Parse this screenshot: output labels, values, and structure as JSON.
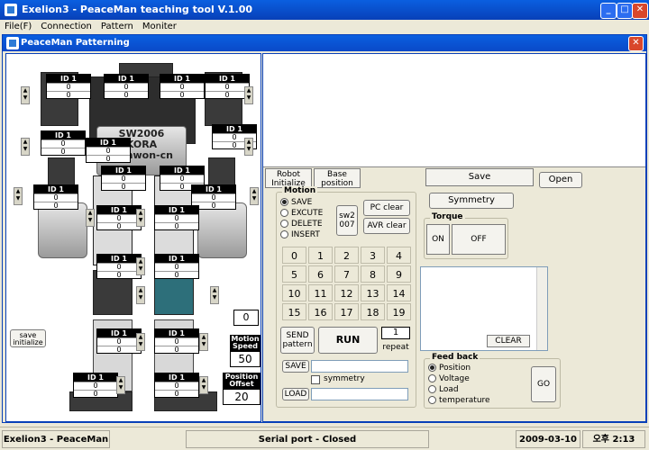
{
  "window": {
    "title": "Exelion3 - PeaceMan teaching tool V.1.00"
  },
  "menu": [
    "File(F)",
    "Connection",
    "Pattern",
    "Moniter"
  ],
  "child": {
    "title": "PeaceMan Patterning"
  },
  "servo": {
    "id_label": "ID 1",
    "value": "0"
  },
  "robot": {
    "chest_text": "SW2006\nKORA\nsamwon-cn"
  },
  "left_controls": {
    "save_initialize": "save\ninitialize",
    "counter": "0",
    "motion_speed_label": "Motion\nSpeed",
    "motion_speed_value": "50",
    "position_offset_label": "Position\nOffset",
    "position_offset_value": "20"
  },
  "tabs": {
    "robot_initialize": "Robot\nInitialize",
    "base_position": "Base\nposition",
    "save": "Save",
    "open": "Open"
  },
  "symmetry_btn": "Symmetry",
  "motion": {
    "legend": "Motion",
    "radios": [
      "SAVE",
      "EXCUTE",
      "DELETE",
      "INSERT"
    ],
    "selected": "SAVE",
    "sw_btn": "sw2\n007",
    "pc_clear": "PC clear",
    "avr_clear": "AVR clear",
    "numbers": [
      "0",
      "1",
      "2",
      "3",
      "4",
      "5",
      "6",
      "7",
      "8",
      "9",
      "10",
      "11",
      "12",
      "13",
      "14",
      "15",
      "16",
      "17",
      "18",
      "19"
    ],
    "send_pattern": "SEND\npattern",
    "run": "RUN",
    "repeat_value": "1",
    "repeat_label": "repeat",
    "save_btn": "SAVE",
    "symmetry_chk": "symmetry",
    "load_btn": "LOAD"
  },
  "torque": {
    "legend": "Torque",
    "on": "ON",
    "off": "OFF"
  },
  "clear_btn": "CLEAR",
  "feedback": {
    "legend": "Feed back",
    "radios": [
      "Position",
      "Voltage",
      "Load",
      "temperature"
    ],
    "selected": "Position",
    "go": "GO"
  },
  "statusbar": {
    "app": "Exelion3 - PeaceMan",
    "port": "Serial port - Closed",
    "date": "2009-03-10",
    "time": "오후 2:13"
  }
}
